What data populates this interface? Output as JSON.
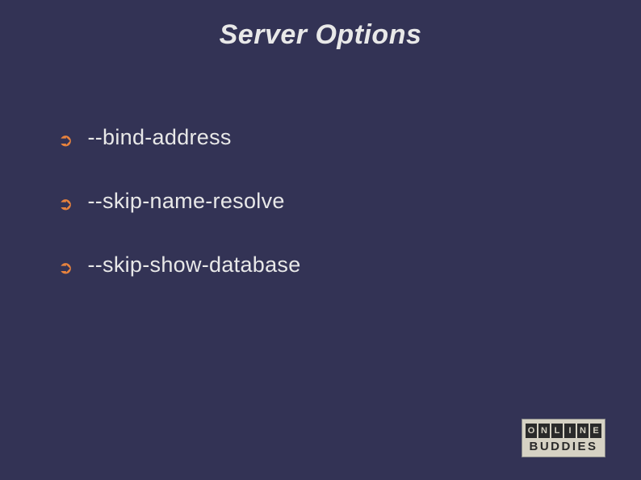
{
  "title": "Server Options",
  "items": [
    "--bind-address",
    "--skip-name-resolve",
    "--skip-show-database"
  ],
  "logo": {
    "top_letters": [
      "O",
      "N",
      "L",
      "I",
      "N",
      "E"
    ],
    "bottom": "BUDDIES"
  }
}
